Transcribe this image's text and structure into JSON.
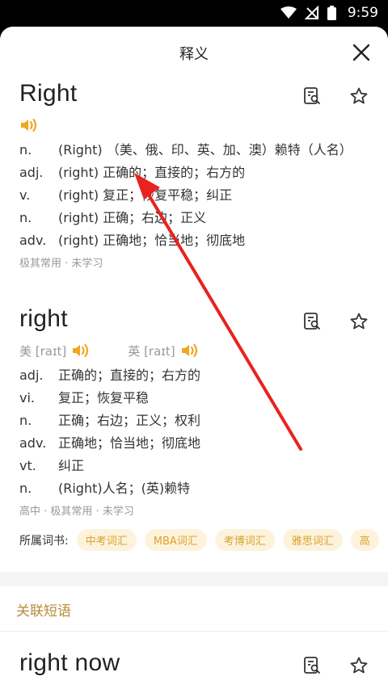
{
  "status": {
    "time": "9:59"
  },
  "sheet": {
    "title": "释义"
  },
  "entries": [
    {
      "word": "Right",
      "definitions": [
        {
          "pos": "n.",
          "text": "(Right) （美、俄、印、英、加、澳）赖特（人名）"
        },
        {
          "pos": "adj.",
          "text": "(right) 正确的；直接的；右方的"
        },
        {
          "pos": "v.",
          "text": "(right) 复正；恢复平稳；纠正"
        },
        {
          "pos": "n.",
          "text": "(right) 正确；右边；正义"
        },
        {
          "pos": "adv.",
          "text": "(right) 正确地；恰当地；彻底地"
        }
      ],
      "meta": "极其常用 · 未学习"
    },
    {
      "word": "right",
      "pron_us": "美 [raɪt]",
      "pron_uk": "英 [raɪt]",
      "definitions": [
        {
          "pos": "adj.",
          "text": "正确的；直接的；右方的"
        },
        {
          "pos": "vi.",
          "text": "复正；恢复平稳"
        },
        {
          "pos": "n.",
          "text": "正确；右边；正义；权利"
        },
        {
          "pos": "adv.",
          "text": "正确地；恰当地；彻底地"
        },
        {
          "pos": "vt.",
          "text": "纠正"
        },
        {
          "pos": "n.",
          "text": "(Right)人名；(英)赖特"
        }
      ],
      "meta": "高中 · 极其常用 · 未学习",
      "books_label": "所属词书:",
      "books": [
        "中考词汇",
        "MBA词汇",
        "考博词汇",
        "雅思词汇",
        "高"
      ]
    }
  ],
  "related": {
    "title": "关联短语",
    "first_phrase": "right now"
  },
  "colors": {
    "accent": "#f0a81e",
    "chip_bg": "#fdf3dc",
    "section_title": "#b88a3a",
    "arrow": "#e8221f"
  }
}
